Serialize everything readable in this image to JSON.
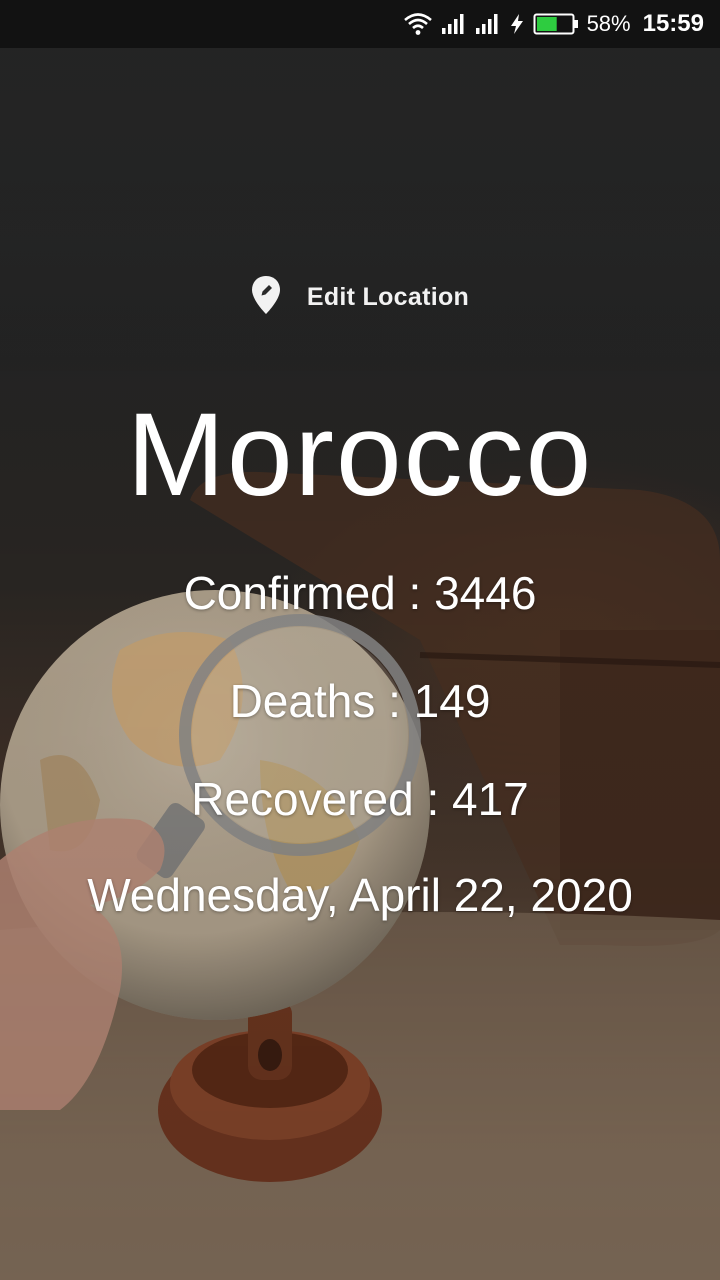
{
  "status_bar": {
    "battery_percent": "58%",
    "battery_level": 0.58,
    "time": "15:59",
    "icons": [
      "wifi-icon",
      "signal-icon",
      "signal-icon",
      "charging-icon",
      "battery-icon"
    ]
  },
  "location": {
    "edit_label": "Edit Location",
    "icon": "location-pin-edit-icon"
  },
  "country": "Morocco",
  "stats": {
    "confirmed": "Confirmed : 3446",
    "deaths": "Deaths : 149",
    "recovered": "Recovered : 417"
  },
  "date": "Wednesday, April 22, 2020",
  "colors": {
    "text": "#ffffff",
    "battery_fill": "#2ecc40",
    "status_bar": "#121212"
  }
}
